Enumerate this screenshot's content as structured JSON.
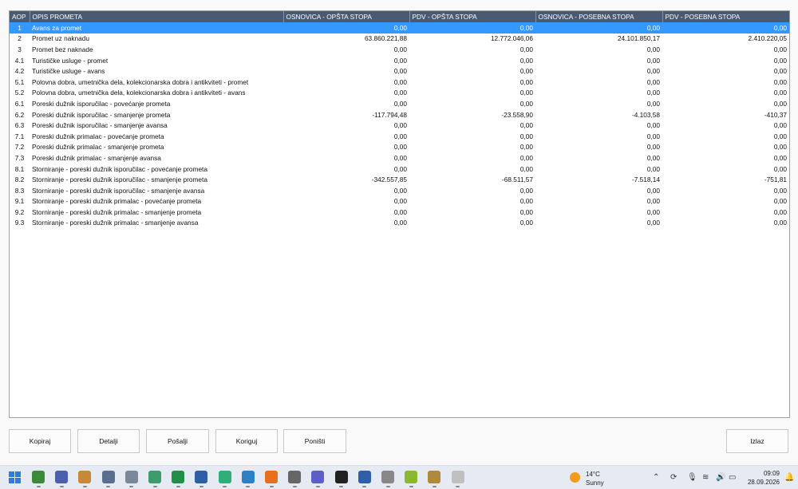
{
  "table": {
    "headers": [
      "AOP",
      "OPIS PROMETA",
      "OSNOVICA - OPŠTA STOPA",
      "PDV - OPŠTA STOPA",
      "OSNOVICA - POSEBNA STOPA",
      "PDV - POSEBNA STOPA"
    ],
    "selected_row": 0,
    "rows": [
      [
        "1",
        "Avans za promet",
        "0,00",
        "0,00",
        "0,00",
        "0,00"
      ],
      [
        "2",
        "Promet uz naknadu",
        "63.860.221,88",
        "12.772.046,06",
        "24.101.850,17",
        "2.410.220,05"
      ],
      [
        "3",
        "Promet bez naknade",
        "0,00",
        "0,00",
        "0,00",
        "0,00"
      ],
      [
        "4.1",
        "Turističke usluge - promet",
        "0,00",
        "0,00",
        "0,00",
        "0,00"
      ],
      [
        "4.2",
        "Turističke usluge - avans",
        "0,00",
        "0,00",
        "0,00",
        "0,00"
      ],
      [
        "5.1",
        "Polovna dobra, umetnička dela, kolekcionarska dobra i antikviteti - promet",
        "0,00",
        "0,00",
        "0,00",
        "0,00"
      ],
      [
        "5.2",
        "Polovna dobra, umetnička dela, kolekcionarska dobra i antikviteti - avans",
        "0,00",
        "0,00",
        "0,00",
        "0,00"
      ],
      [
        "6.1",
        "Poreski dužnik isporučilac - povećanje prometa",
        "0,00",
        "0,00",
        "0,00",
        "0,00"
      ],
      [
        "6.2",
        "Poreski dužnik isporučilac - smanjenje prometa",
        "-117.794,48",
        "-23.558,90",
        "-4.103,58",
        "-410,37"
      ],
      [
        "6.3",
        "Poreski dužnik isporučilac - smanjenje avansa",
        "0,00",
        "0,00",
        "0,00",
        "0,00"
      ],
      [
        "7.1",
        "Poreski dužnik primalac - povećanje prometa",
        "0,00",
        "0,00",
        "0,00",
        "0,00"
      ],
      [
        "7.2",
        "Poreski dužnik primalac - smanjenje prometa",
        "0,00",
        "0,00",
        "0,00",
        "0,00"
      ],
      [
        "7.3",
        "Poreski dužnik primalac - smanjenje avansa",
        "0,00",
        "0,00",
        "0,00",
        "0,00"
      ],
      [
        "8.1",
        "Storniranje - poreski dužnik isporučilac - povećanje prometa",
        "0,00",
        "0,00",
        "0,00",
        "0,00"
      ],
      [
        "8.2",
        "Storniranje - poreski dužnik isporučilac - smanjenje prometa",
        "-342.557,85",
        "-68.511,57",
        "-7.518,14",
        "-751,81"
      ],
      [
        "8.3",
        "Storniranje - poreski dužnik isporučilac - smanjenje avansa",
        "0,00",
        "0,00",
        "0,00",
        "0,00"
      ],
      [
        "9.1",
        "Storniranje - poreski dužnik primalac - povećanje prometa",
        "0,00",
        "0,00",
        "0,00",
        "0,00"
      ],
      [
        "9.2",
        "Storniranje - poreski dužnik primalac - smanjenje prometa",
        "0,00",
        "0,00",
        "0,00",
        "0,00"
      ],
      [
        "9.3",
        "Storniranje - poreski dužnik primalac - smanjenje avansa",
        "0,00",
        "0,00",
        "0,00",
        "0,00"
      ]
    ]
  },
  "buttons": {
    "copy": "Kopiraj",
    "details": "Detalji",
    "send": "Pošalji",
    "correct": "Koriguj",
    "cancel": "Poništi",
    "exit": "Izlaz"
  },
  "taskbar": {
    "weather_temp": "14°C",
    "weather_desc": "Sunny",
    "time": "09:09",
    "date": "28.09.2026",
    "apps": [
      "start-icon",
      "notepad-icon",
      "save-icon",
      "app-icon",
      "postgres-icon",
      "window-icon",
      "photos-icon",
      "excel-icon",
      "network-icon",
      "chat-icon",
      "browser-icon",
      "firefox-icon",
      "tools-icon",
      "teams-icon",
      "github-icon",
      "document-icon",
      "phone-icon",
      "upload-icon",
      "app2-icon",
      "app3-icon"
    ]
  },
  "colors": {
    "header_bg": "#4a5a73",
    "selected_row_bg": "#3399ff"
  }
}
